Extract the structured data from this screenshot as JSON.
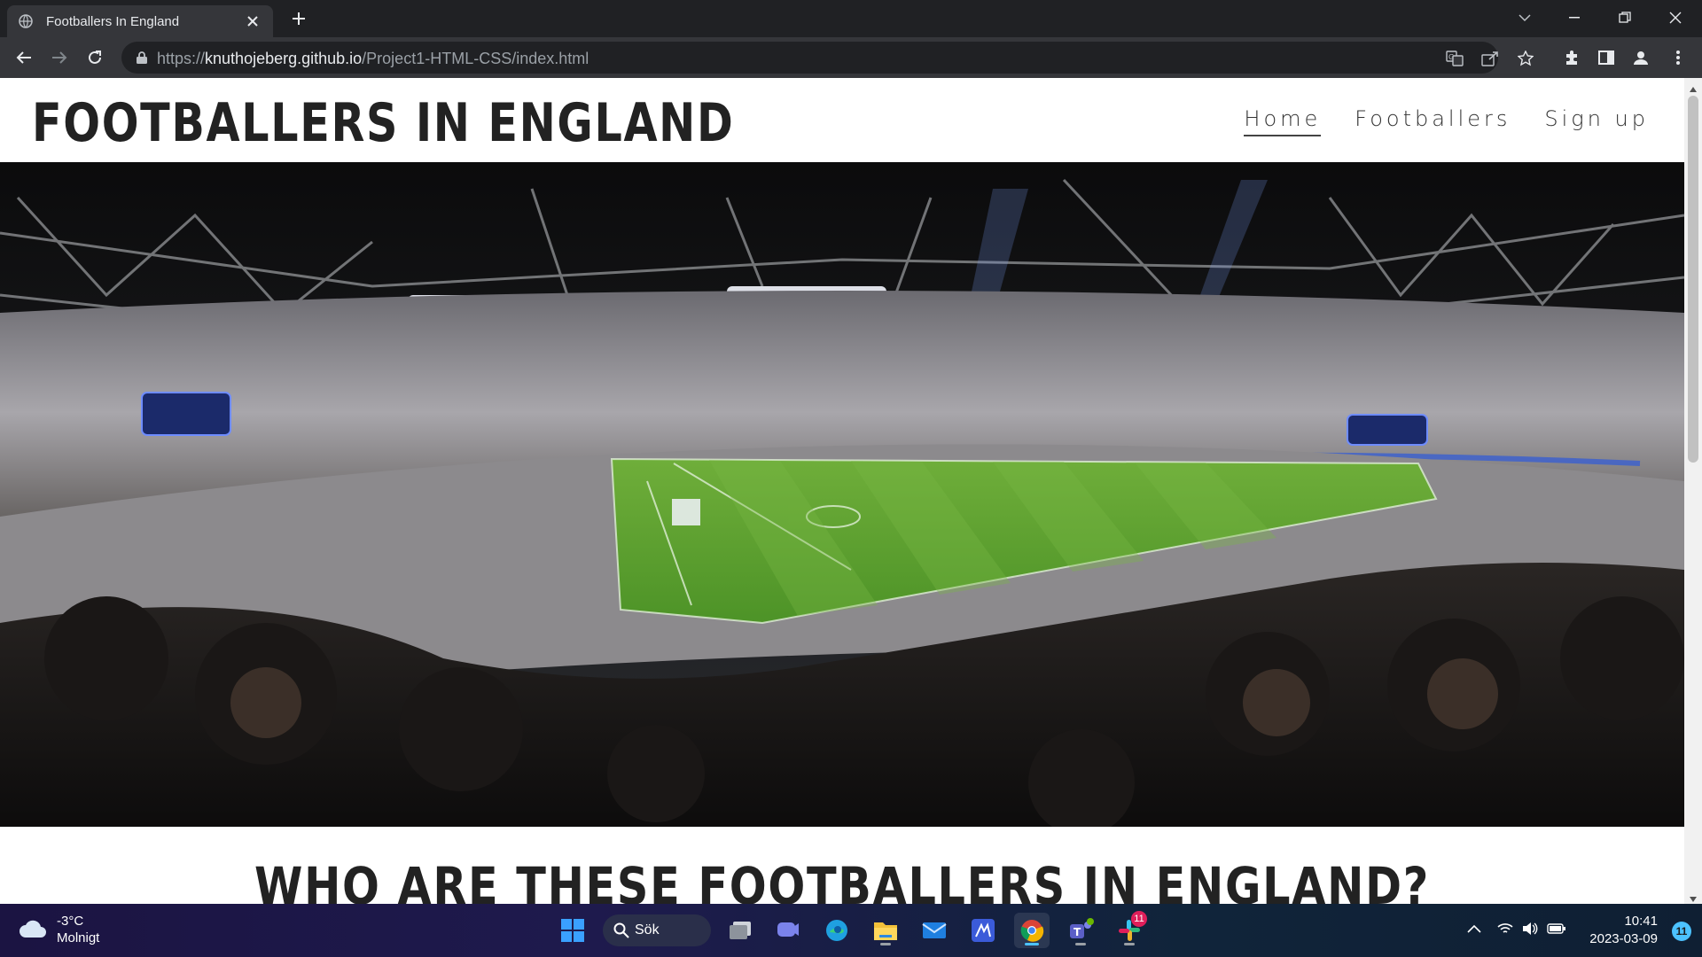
{
  "browser": {
    "tab_title": "Footballers In England",
    "url_scheme": "https://",
    "url_host": "knuthojeberg.github.io",
    "url_path": "/Project1-HTML-CSS/index.html"
  },
  "site": {
    "logo": "FOOTBALLERS IN ENGLAND",
    "nav": [
      {
        "label": "Home",
        "active": true
      },
      {
        "label": "Footballers",
        "active": false
      },
      {
        "label": "Sign up",
        "active": false
      }
    ],
    "section_title": "WHO ARE THESE FOOTBALLERS IN ENGLAND?",
    "hero_icon": "stadium-photo"
  },
  "taskbar": {
    "weather_temp": "-3°C",
    "weather_desc": "Molnigt",
    "search_label": "Sök",
    "slack_badge": "11",
    "time": "10:41",
    "date": "2023-03-09",
    "notification_count": "11"
  },
  "colors": {
    "chrome_dark": "#202124",
    "chrome_toolbar": "#35363a",
    "pitch_green": "#5aa02c",
    "accent": "#4cc2ff"
  }
}
